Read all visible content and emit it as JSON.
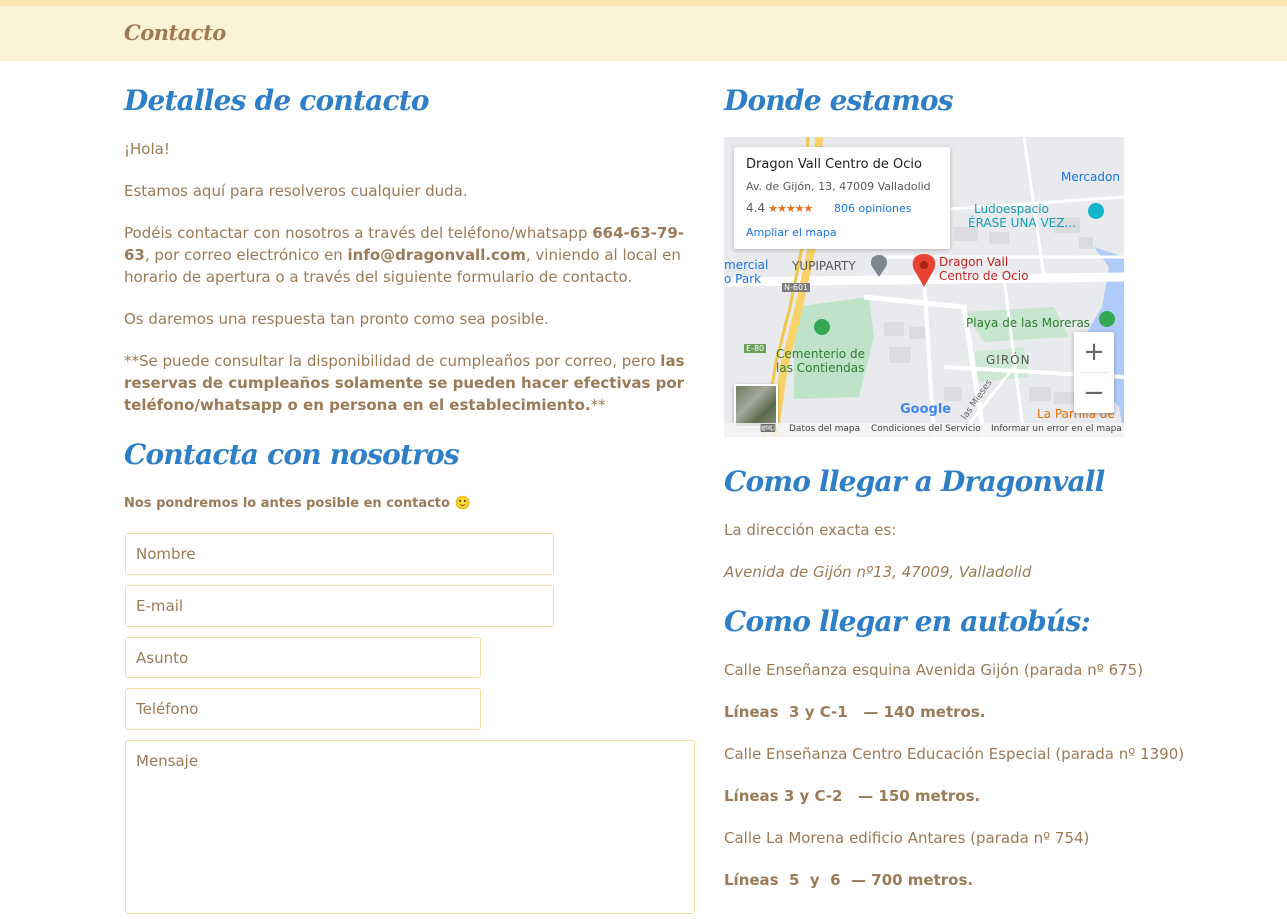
{
  "header": {
    "title": "Contacto"
  },
  "left": {
    "details_heading": "Detalles de contacto",
    "greeting": "¡Hola!",
    "intro": "Estamos aquí para resolveros cualquier duda.",
    "contact_pre": "Podéis contactar con nosotros a través del teléfono/whatsapp ",
    "phone": "664-63-79-63",
    "contact_mid": ", por correo electrónico en ",
    "email": "info@dragonvall.com",
    "contact_post": ",  viniendo al local en horario de apertura o a través del siguiente formulario de contacto.",
    "reply": "Os daremos una respuesta tan pronto como sea posible.",
    "note_pre": "**Se puede consultar la disponibilidad de cumpleaños por correo, pero ",
    "note_bold": "las reservas de cumpleaños solamente se pueden hacer efectivas por teléfono/whatsapp o en persona en el establecimiento.",
    "note_post": "**",
    "form_heading": "Contacta con nosotros",
    "form_intro": "Nos pondremos lo antes posible en contacto 🙂",
    "form": {
      "name_placeholder": "Nombre",
      "email_placeholder": "E-mail",
      "subject_placeholder": "Asunto",
      "phone_placeholder": "Teléfono",
      "message_placeholder": "Mensaje"
    }
  },
  "right": {
    "where_heading": "Donde estamos",
    "map": {
      "place_name": "Dragon Vall Centro de Ocio",
      "place_address": "Av. de Gijón, 13, 47009 Valladolid",
      "rating": "4.4",
      "stars": "★★★★★",
      "reviews": "806 opiniones",
      "enlarge": "Ampliar el mapa",
      "marker_label_1": "Dragon Vall",
      "marker_label_2": "Centro de Ocio",
      "labels": {
        "mercadona": "Mercadon",
        "ludo_1": "Ludoespacio",
        "ludo_2": "ÉRASE UNA VEZ...",
        "yupiparty": "YUPIPARTY",
        "comercial_1": "mercial",
        "comercial_2": "o Park",
        "n601": "N-601",
        "e80": "E-80",
        "cementerio_1": "Cementerio de",
        "cementerio_2": "las Contiendas",
        "playa": "Playa de las Moreras",
        "giron": "GIRÓN",
        "las_mieses": "las Mieses",
        "la_parrilla": "La Parrilla de",
        "google": "Google"
      },
      "zoom_in": "+",
      "zoom_out": "−",
      "footer": {
        "keyboard": "⌨",
        "map_data": "Datos del mapa",
        "terms": "Condiciones del Servicio",
        "report": "Informar un error en el mapa"
      }
    },
    "directions_heading": "Como llegar a Dragonvall",
    "address_label": "La dirección exacta es:",
    "address": "Avenida de Gijón nº13, 47009, Valladolid",
    "bus_heading": "Como llegar en autobús:",
    "stops": [
      {
        "stop": "Calle Enseñanza esquina Avenida Gijón (parada nº 675)",
        "lines": "Líneas  3 y C-1   — 140 metros."
      },
      {
        "stop": "Calle Enseñanza Centro Educación Especial (parada nº 1390)",
        "lines": "Líneas 3 y C-2   — 150 metros."
      },
      {
        "stop": "Calle La Morena edificio Antares (parada nº 754)",
        "lines": "Líneas  5  y  6  — 700 metros."
      }
    ]
  }
}
